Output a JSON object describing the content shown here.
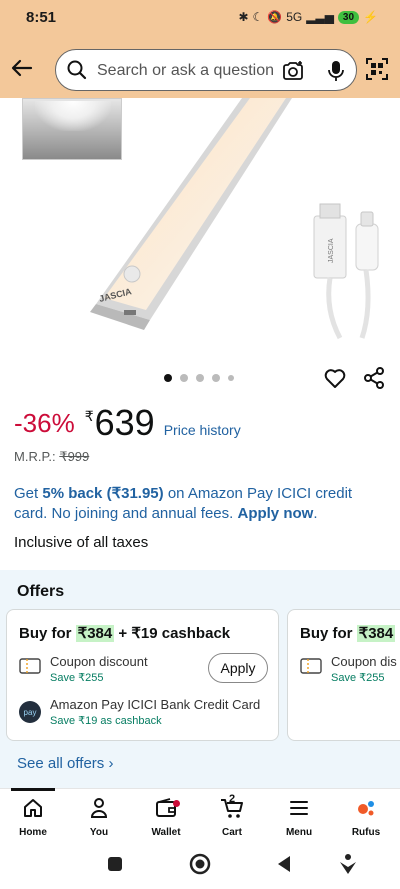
{
  "status_bar": {
    "time": "8:51",
    "network": "5G",
    "battery": "30"
  },
  "search": {
    "placeholder": "Search or ask a question"
  },
  "gallery": {
    "image_count": 5,
    "active_index": 0,
    "product_label": "JASCIA"
  },
  "price": {
    "discount": "-36%",
    "currency": "₹",
    "amount": "639",
    "history_link": "Price history",
    "mrp_label": "M.R.P.:",
    "mrp_value": "₹999"
  },
  "cashback": {
    "prefix": "Get ",
    "percent": "5% back",
    "amount": "(₹31.95)",
    "middle": " on Amazon Pay ICICI credit card. No joining and annual fees. ",
    "cta": "Apply now",
    "suffix": "."
  },
  "taxes": "Inclusive of all taxes",
  "offers": {
    "title": "Offers",
    "cards": [
      {
        "buy_for": "Buy for",
        "price": "₹384",
        "extra": "+ ₹19 cashback",
        "coupon_label": "Coupon discount",
        "coupon_save": "Save ₹255",
        "apply": "Apply",
        "bank_label": "Amazon Pay ICICI Bank Credit Card",
        "bank_save": "Save ₹19 as cashback"
      },
      {
        "buy_for": "Buy for",
        "price": "₹384",
        "coupon_label": "Coupon dis",
        "coupon_save": "Save ₹255"
      }
    ],
    "see_all": "See all offers ›"
  },
  "nav": {
    "items": [
      {
        "label": "Home"
      },
      {
        "label": "You"
      },
      {
        "label": "Wallet"
      },
      {
        "label": "Cart",
        "count": "2"
      },
      {
        "label": "Menu"
      },
      {
        "label": "Rufus"
      }
    ]
  },
  "colors": {
    "header_bg": "#f3c89a",
    "discount": "#cc0c39",
    "link": "#2162a1",
    "highlight": "#c6f2c6"
  }
}
